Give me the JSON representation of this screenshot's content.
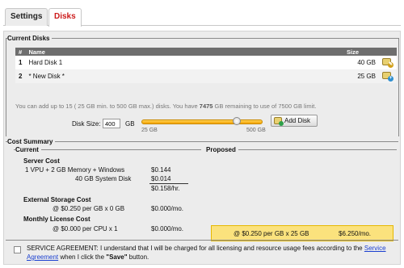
{
  "tabs": [
    {
      "label": "Settings",
      "active": false
    },
    {
      "label": "Disks",
      "active": true
    }
  ],
  "current_disks": {
    "title": "Current Disks",
    "columns": {
      "num": "#",
      "name": "Name",
      "size": "Size"
    },
    "rows": [
      {
        "num": "1",
        "name": "Hard Disk 1",
        "size": "40 GB",
        "icon": "disk-edit-icon"
      },
      {
        "num": "2",
        "name": "* New Disk *",
        "size": "25 GB",
        "icon": "disk-add-icon"
      }
    ],
    "note_prefix": "You can add up to 15 ( 25 GB min. to 500 GB max.) disks. You have ",
    "note_bold": "7475",
    "note_suffix": " GB remaining to use of 7500 GB limit."
  },
  "disk_size": {
    "label": "Disk Size:",
    "value": "400",
    "unit": "GB",
    "slider_min_label": "25 GB",
    "slider_max_label": "500 GB",
    "slider_value_fraction": 0.789,
    "add_button": "Add Disk"
  },
  "cost_summary": {
    "title": "Cost Summary",
    "current_title": "Current",
    "proposed_title": "Proposed",
    "server_cost_label": "Server Cost",
    "line1_label": "1 VPU + 2 GB Memory  + Windows",
    "line1_value": "$0.144",
    "line2_label": "40 GB System Disk",
    "line2_value": "$0.014",
    "total_value": "$0.158/hr.",
    "external_storage_label": "External Storage Cost",
    "external_current_rate": "@ $0.250 per GB x 0 GB",
    "external_current_value": "$0.000/mo.",
    "external_proposed_rate": "@ $0.250 per GB x 25 GB",
    "external_proposed_value": "$6.250/mo.",
    "license_label": "Monthly License Cost",
    "license_rate": "@ $0.000 per CPU x 1",
    "license_value": "$0.000/mo."
  },
  "agreement": {
    "text_before": "SERVICE AGREEMENT: I understand that I will be charged for all licensing and resource usage fees according to the ",
    "link_text": "Service Agreement",
    "text_mid": " when I click the ",
    "bold_text": "\"Save\"",
    "text_after": " button."
  }
}
